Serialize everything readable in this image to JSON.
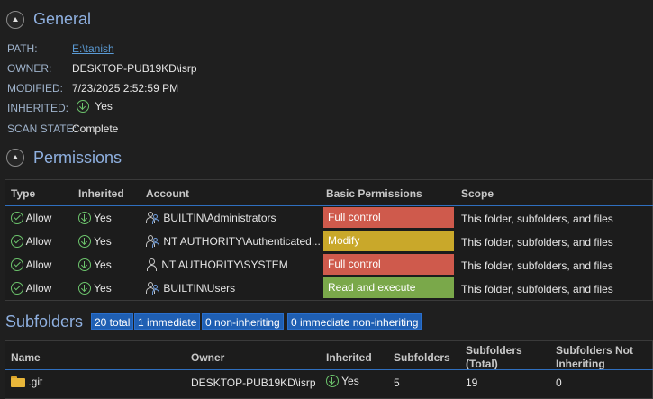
{
  "general": {
    "title": "General",
    "path_label": "PATH:",
    "path_value": "E:\\tanish",
    "owner_label": "OWNER:",
    "owner_value": "DESKTOP-PUB19KD\\isrp",
    "modified_label": "MODIFIED:",
    "modified_value": "7/23/2025 2:52:59 PM",
    "inherited_label": "INHERITED:",
    "inherited_value": "Yes",
    "scan_label": "SCAN STATE:",
    "scan_value": "Complete"
  },
  "permissions": {
    "title": "Permissions",
    "columns": [
      "Type",
      "Inherited",
      "Account",
      "Basic Permissions",
      "Scope"
    ],
    "rows": [
      {
        "type": "Allow",
        "inherited": "Yes",
        "account": "BUILTIN\\Administrators",
        "account_icon": "group-icon",
        "permission": "Full control",
        "perm_color": "#cf5a4c",
        "scope": "This folder, subfolders, and files"
      },
      {
        "type": "Allow",
        "inherited": "Yes",
        "account": "NT AUTHORITY\\Authenticated...",
        "account_icon": "group-icon",
        "permission": "Modify",
        "perm_color": "#c9a82a",
        "scope": "This folder, subfolders, and files"
      },
      {
        "type": "Allow",
        "inherited": "Yes",
        "account": "NT AUTHORITY\\SYSTEM",
        "account_icon": "user-icon",
        "permission": "Full control",
        "perm_color": "#cf5a4c",
        "scope": "This folder, subfolders, and files"
      },
      {
        "type": "Allow",
        "inherited": "Yes",
        "account": "BUILTIN\\Users",
        "account_icon": "group-icon",
        "permission": "Read and execute",
        "perm_color": "#7aa84a",
        "scope": "This folder, subfolders, and files"
      }
    ]
  },
  "subfolders": {
    "title": "Subfolders",
    "badges": [
      "20 total",
      "1 immediate",
      "0 non-inheriting",
      "0 immediate non-inheriting"
    ],
    "columns": {
      "name": "Name",
      "owner": "Owner",
      "inherited": "Inherited",
      "subfolders": "Subfolders",
      "subfolders_total_1": "Subfolders",
      "subfolders_total_2": "(Total)",
      "not_inheriting_1": "Subfolders Not",
      "not_inheriting_2": "Inheriting"
    },
    "rows": [
      {
        "name": ".git",
        "owner": "DESKTOP-PUB19KD\\isrp",
        "inherited": "Yes",
        "subfolders": "5",
        "subfolders_total": "19",
        "not_inheriting": "0"
      }
    ]
  }
}
